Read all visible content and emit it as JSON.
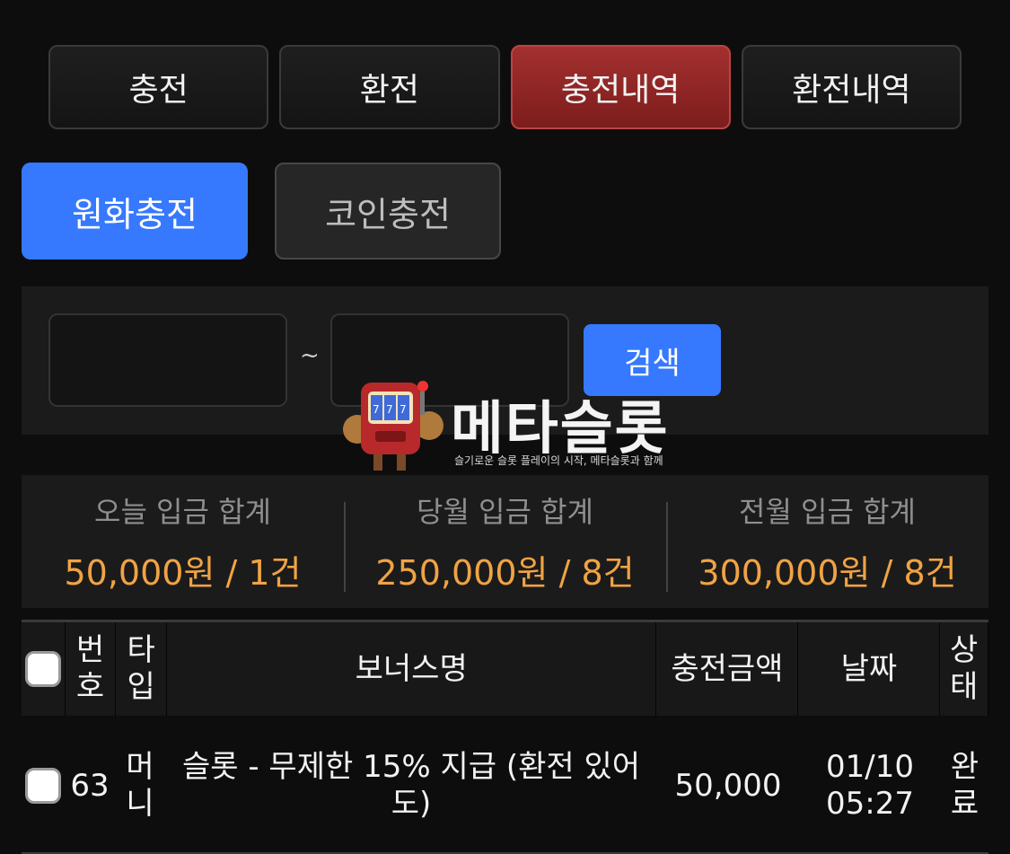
{
  "tabs": [
    {
      "label": "충전",
      "active": false
    },
    {
      "label": "환전",
      "active": false
    },
    {
      "label": "충전내역",
      "active": true
    },
    {
      "label": "환전내역",
      "active": false
    }
  ],
  "subtabs": {
    "primary": "원화충전",
    "secondary": "코인충전"
  },
  "search": {
    "separator": "~",
    "button": "검색"
  },
  "watermark": {
    "brand": "메타슬롯",
    "tagline": "슬기로운 슬롯 플레이의 시작, 메타슬롯과 함께"
  },
  "summary": [
    {
      "label": "오늘 입금 합계",
      "value": "50,000원 / 1건"
    },
    {
      "label": "당월 입금 합계",
      "value": "250,000원 / 8건"
    },
    {
      "label": "전월 입금 합계",
      "value": "300,000원 / 8건"
    }
  ],
  "table": {
    "headers": {
      "no": "번호",
      "type": "타입",
      "name": "보너스명",
      "amount": "충전금액",
      "date": "날짜",
      "status": "상태"
    },
    "rows": [
      {
        "no": "63",
        "type": "머니",
        "name": "슬롯 - 무제한 15% 지급 (환전 있어도)",
        "amount": "50,000",
        "date": "01/10 05:27",
        "status": "완료"
      }
    ]
  },
  "colors": {
    "accent_blue": "#3679ff",
    "active_tab_red": "#a3302f",
    "amount_orange": "#f0a344"
  }
}
